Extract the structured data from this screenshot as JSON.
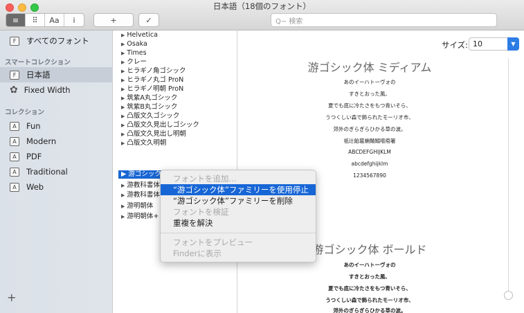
{
  "window": {
    "title": "日本語（18個のフォント）"
  },
  "toolbar": {
    "view_buttons": [
      "≡",
      "⠿",
      "Aa",
      "i"
    ],
    "add_label": "+",
    "check_label": "✓",
    "search_placeholder": "Q~ 検索"
  },
  "sidebar": {
    "all_fonts": "すべてのフォント",
    "smart_header": "スマートコレクション",
    "smart_items": [
      "日本語",
      "Fixed Width"
    ],
    "collections_header": "コレクション",
    "collections": [
      "Fun",
      "Modern",
      "PDF",
      "Traditional",
      "Web"
    ],
    "add_label": "+"
  },
  "font_list": {
    "items": [
      "Helvetica",
      "Osaka",
      "Times",
      "クレー",
      "ヒラギノ角ゴシック",
      "ヒラギノ丸ゴ ProN",
      "ヒラギノ明朝 ProN",
      "筑紫A丸ゴシック",
      "筑紫B丸ゴシック",
      "凸版文久ゴシック",
      "凸版文久見出しゴシック",
      "凸版文久見出し明朝",
      "凸版文久明朝"
    ],
    "selected": "游ゴシック体",
    "after": [
      "游教科書体",
      "游教科書体",
      "游明朝体",
      "游明朝体+"
    ]
  },
  "preview": {
    "size_label": "サイズ:",
    "size_value": "10",
    "sample1": {
      "title": "游ゴシック体 ミディアム",
      "lines": [
        "あのイーハトーヴォの",
        "すきとおった風、",
        "夏でも底に冷たさをもつ青いそら、",
        "うつくしい森で飾られたモーリオ市、",
        "郊外のぎらぎらひかる草の波。",
        "祇辻飴葛蛸鯖鰯噌庖箸",
        "ABCDEFGHIJKLM",
        "abcdefghijklm",
        "1234567890"
      ]
    },
    "sample2": {
      "title": "游ゴシック体 ボールド",
      "lines": [
        "あのイーハトーヴォの",
        "すきとおった風、",
        "夏でも底に冷たさをもつ青いそら、",
        "うつくしい森で飾られたモーリオ市、",
        "郊外のぎらぎらひかる草の波。"
      ]
    }
  },
  "context_menu": {
    "add_font": "フォントを追加...",
    "disable_family": "“游ゴシック体”ファミリーを使用停止",
    "delete_family": "“游ゴシック体”ファミリーを削除",
    "validate": "フォントを検証",
    "resolve_duplicates": "重複を解決",
    "preview_font": "フォントをプレビュー",
    "show_in_finder": "Finderに表示"
  }
}
